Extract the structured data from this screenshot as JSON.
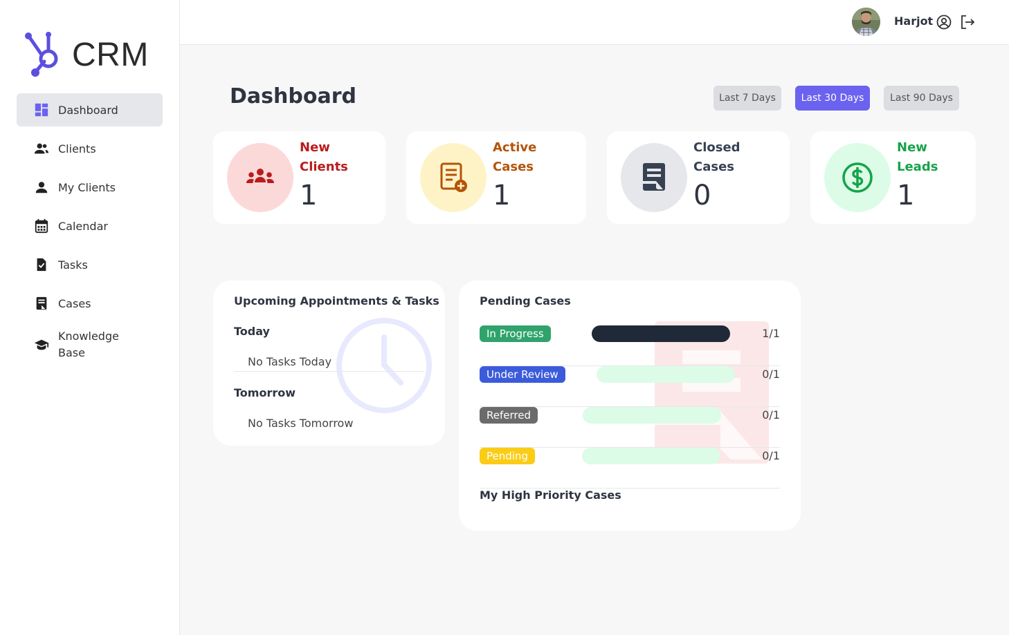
{
  "app": {
    "logo_text": "CRM",
    "brand_color": "#6b62f0"
  },
  "sidebar": {
    "items": [
      {
        "label": "Dashboard",
        "icon": "dashboard-icon",
        "active": true
      },
      {
        "label": "Clients",
        "icon": "group-icon"
      },
      {
        "label": "My Clients",
        "icon": "person-icon"
      },
      {
        "label": "Calendar",
        "icon": "calendar-icon"
      },
      {
        "label": "Tasks",
        "icon": "task-icon"
      },
      {
        "label": "Cases",
        "icon": "cases-icon"
      },
      {
        "label": "Knowledge\nBase",
        "icon": "graduation-cap-icon"
      }
    ]
  },
  "header": {
    "user_name": "Harjot",
    "profile_icon": "account-circle-icon",
    "logout_icon": "logout-icon"
  },
  "main": {
    "title": "Dashboard",
    "ranges": [
      {
        "label": "Last 7 Days",
        "active": false
      },
      {
        "label": "Last 30 Days",
        "active": true
      },
      {
        "label": "Last 90 Days",
        "active": false
      }
    ],
    "stats": [
      {
        "label": "New\nClients",
        "value": "1",
        "color": "#b91c1c",
        "bg": "#fcd9d9",
        "icon": "groups-icon"
      },
      {
        "label": "Active\nCases",
        "value": "1",
        "color": "#b45309",
        "bg": "#fef3c7",
        "icon": "add-document-icon"
      },
      {
        "label": "Closed\nCases",
        "value": "0",
        "color": "#374151",
        "bg": "#e5e7eb",
        "icon": "closed-case-icon"
      },
      {
        "label": "New\nLeads",
        "value": "1",
        "color": "#16a34a",
        "bg": "#dcfce7",
        "icon": "dollar-icon"
      }
    ],
    "upcoming": {
      "title": "Upcoming Appointments & Tasks",
      "today_label": "Today",
      "today_empty": "No Tasks Today",
      "tomorrow_label": "Tomorrow",
      "tomorrow_empty": "No Tasks Tomorrow"
    },
    "pending": {
      "title": "Pending Cases",
      "rows": [
        {
          "label": "In Progress",
          "ratio": "1/1",
          "fraction": 1.0,
          "color": "#2fa36b"
        },
        {
          "label": "Under Review",
          "ratio": "0/1",
          "fraction": 0.0,
          "color": "#3b5bdb"
        },
        {
          "label": "Referred",
          "ratio": "0/1",
          "fraction": 0.0,
          "color": "#6b6b6b"
        },
        {
          "label": "Pending",
          "ratio": "0/1",
          "fraction": 0.0,
          "color": "#facc15"
        }
      ],
      "high_priority_title": "My High Priority Cases"
    }
  }
}
